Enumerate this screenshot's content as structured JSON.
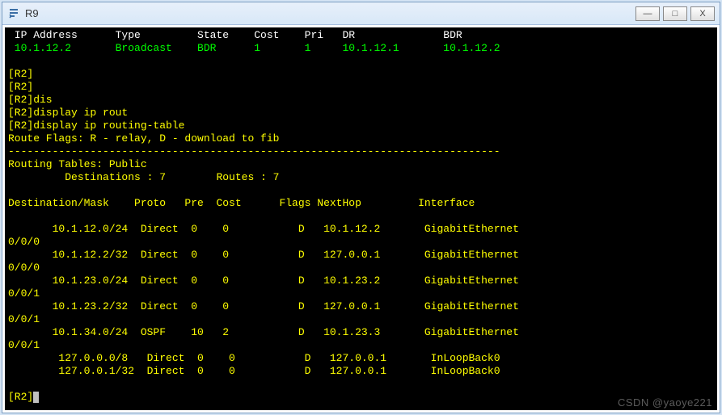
{
  "window": {
    "title": "R9",
    "icon": "app-icon"
  },
  "buttons": {
    "min": "—",
    "max": "□",
    "close": "X"
  },
  "ospf": {
    "header": " IP Address      Type         State    Cost    Pri   DR              BDR",
    "row": " 10.1.12.2       Broadcast    BDR      1       1     10.1.12.1       10.1.12.2"
  },
  "cmds": {
    "p1": "[R2]",
    "p2": "[R2]",
    "p3": "[R2]dis",
    "p4": "[R2]display ip rout",
    "p5": "[R2]display ip routing-table",
    "flags": "Route Flags: R - relay, D - download to fib",
    "dash": "------------------------------------------------------------------------------",
    "rt_hdr": "Routing Tables: Public",
    "rt_cnt": "         Destinations : 7        Routes : 7",
    "blank": "",
    "col_hdr": "Destination/Mask    Proto   Pre  Cost      Flags NextHop         Interface",
    "r1a": "       10.1.12.0/24  Direct  0    0           D   10.1.12.2       GigabitEthernet",
    "r1b": "0/0/0",
    "r2a": "       10.1.12.2/32  Direct  0    0           D   127.0.0.1       GigabitEthernet",
    "r2b": "0/0/0",
    "r3a": "       10.1.23.0/24  Direct  0    0           D   10.1.23.2       GigabitEthernet",
    "r3b": "0/0/1",
    "r4a": "       10.1.23.2/32  Direct  0    0           D   127.0.0.1       GigabitEthernet",
    "r4b": "0/0/1",
    "r5a": "       10.1.34.0/24  OSPF    10   2           D   10.1.23.3       GigabitEthernet",
    "r5b": "0/0/1",
    "r6": "        127.0.0.0/8   Direct  0    0           D   127.0.0.1       InLoopBack0",
    "r7": "        127.0.0.1/32  Direct  0    0           D   127.0.0.1       InLoopBack0",
    "prompt": "[R2]"
  },
  "watermark": "CSDN @yaoye221"
}
